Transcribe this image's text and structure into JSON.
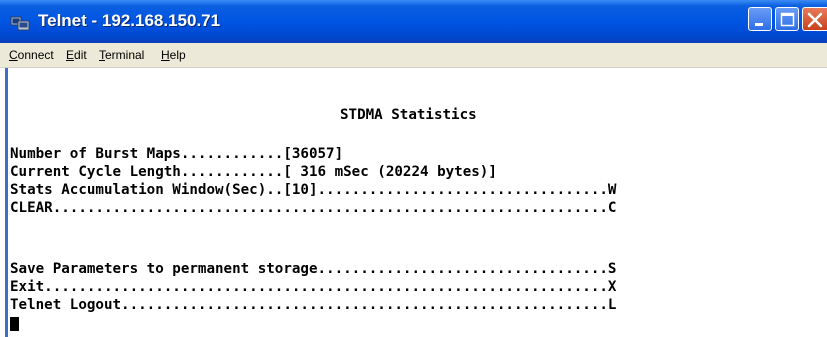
{
  "window": {
    "title": "Telnet - 192.168.150.71",
    "colors": {
      "titlebar": "#0055e3",
      "close": "#d1492a"
    }
  },
  "menu": {
    "items": [
      {
        "label": "Connect",
        "accel": "C",
        "rest": "onnect"
      },
      {
        "label": "Edit",
        "accel": "E",
        "rest": "dit"
      },
      {
        "label": "Terminal",
        "accel": "T",
        "rest": "erminal"
      },
      {
        "label": "Help",
        "accel": "H",
        "rest": "elp"
      }
    ]
  },
  "terminal": {
    "heading": "STDMA Statistics",
    "lines": [
      "Number of Burst Maps............[36057]",
      "Current Cycle Length............[ 316 mSec (20224 bytes)]",
      "Stats Accumulation Window(Sec)..[10]..................................W",
      "CLEAR.................................................................C",
      "Save Parameters to permanent storage..................................S",
      "Exit..................................................................X",
      "Telnet Logout.........................................................L"
    ]
  }
}
